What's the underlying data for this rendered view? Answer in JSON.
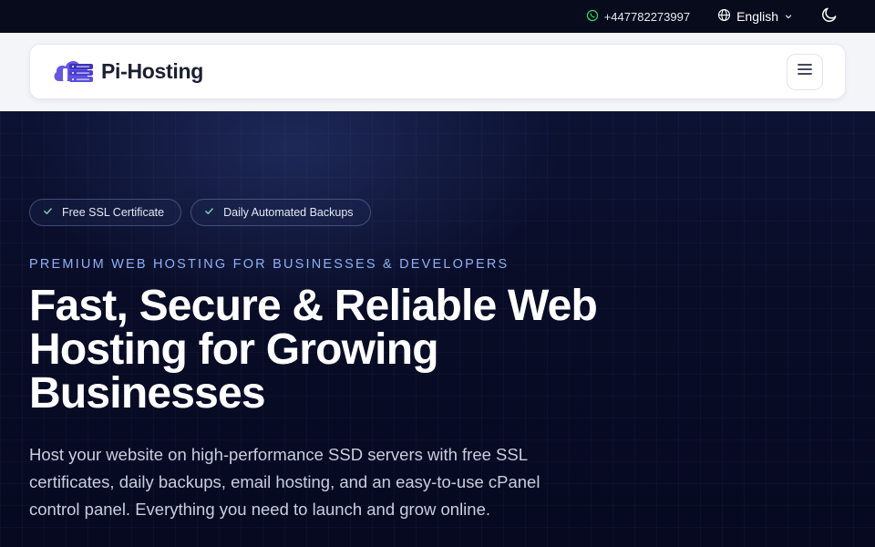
{
  "topbar": {
    "phone": "+447782273997",
    "phone_icon": "whatsapp-icon",
    "language": "English",
    "language_icon": "globe-icon",
    "theme_icon": "moon-icon"
  },
  "header": {
    "logo_text": "Pi-Hosting",
    "logo_icon": "cloud-server-icon",
    "menu_icon": "hamburger-icon"
  },
  "hero": {
    "badges": [
      {
        "label": "Free SSL Certificate",
        "icon": "check-icon"
      },
      {
        "label": "Daily Automated Backups",
        "icon": "check-icon"
      }
    ],
    "eyebrow": "PREMIUM WEB HOSTING FOR BUSINESSES & DEVELOPERS",
    "headline": "Fast, Secure & Reliable Web Hosting for Growing Businesses",
    "subtext": "Host your website on high-performance SSD servers with free SSL certificates, daily backups, email hosting, and an easy-to-use cPanel control panel. Everything you need to launch and grow online."
  },
  "colors": {
    "brand_purple": "#4b3fd6",
    "hero_bg": "#080c26",
    "eyebrow": "#8fb0f2",
    "whatsapp": "#25d366"
  }
}
